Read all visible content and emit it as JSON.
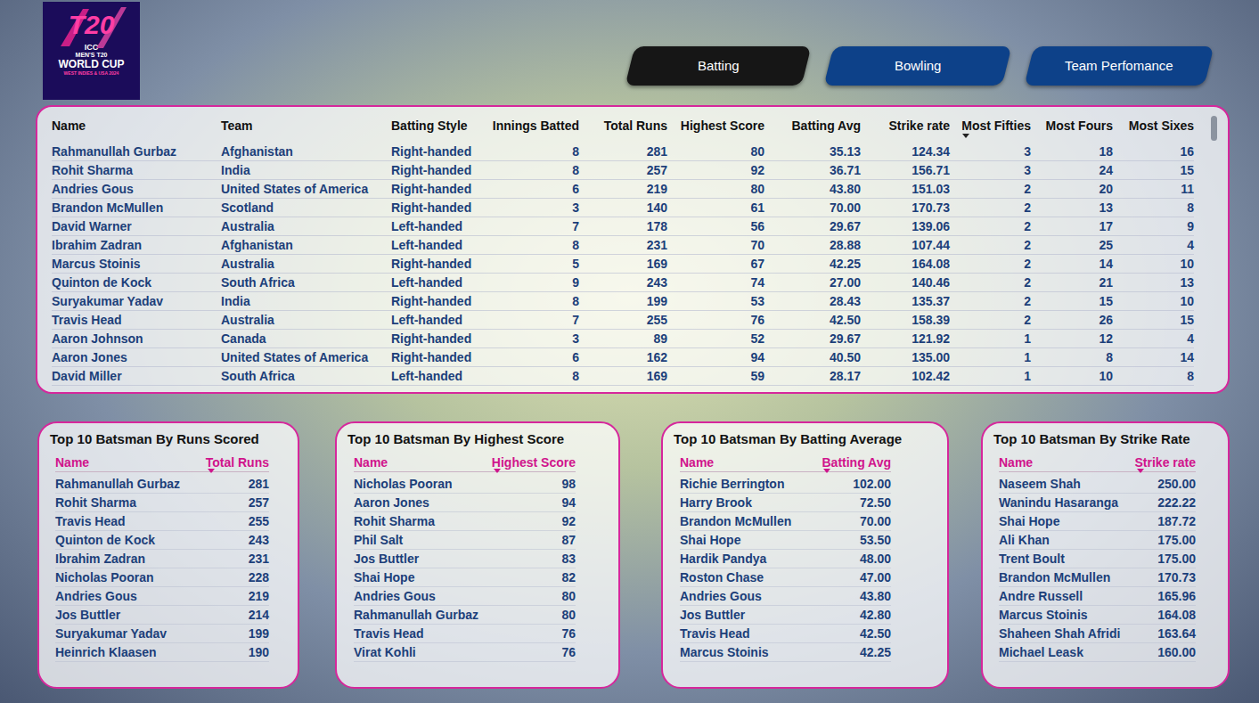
{
  "logo": {
    "mark": "T20",
    "line1": "ICC",
    "line2": "MEN'S T20",
    "line3": "WORLD CUP",
    "line4": "WEST INDIES & USA 2024"
  },
  "tabs": [
    {
      "label": "Batting",
      "selected": true
    },
    {
      "label": "Bowling",
      "selected": false
    },
    {
      "label": "Team Perfomance",
      "selected": false
    }
  ],
  "table": {
    "columns": [
      {
        "label": "Name",
        "sorted": false
      },
      {
        "label": "Team",
        "sorted": false
      },
      {
        "label": "Batting Style",
        "sorted": false
      },
      {
        "label": "Innings Batted",
        "sorted": false
      },
      {
        "label": "Total Runs",
        "sorted": false
      },
      {
        "label": "Highest Score",
        "sorted": false
      },
      {
        "label": "Batting Avg",
        "sorted": false
      },
      {
        "label": "Strike rate",
        "sorted": false
      },
      {
        "label": "Most Fifties",
        "sorted": true
      },
      {
        "label": "Most Fours",
        "sorted": false
      },
      {
        "label": "Most Sixes",
        "sorted": false
      }
    ],
    "rows": [
      [
        "Rahmanullah Gurbaz",
        "Afghanistan",
        "Right-handed",
        "8",
        "281",
        "80",
        "35.13",
        "124.34",
        "3",
        "18",
        "16"
      ],
      [
        "Rohit Sharma",
        "India",
        "Right-handed",
        "8",
        "257",
        "92",
        "36.71",
        "156.71",
        "3",
        "24",
        "15"
      ],
      [
        "Andries Gous",
        "United States of America",
        "Right-handed",
        "6",
        "219",
        "80",
        "43.80",
        "151.03",
        "2",
        "20",
        "11"
      ],
      [
        "Brandon McMullen",
        "Scotland",
        "Right-handed",
        "3",
        "140",
        "61",
        "70.00",
        "170.73",
        "2",
        "13",
        "8"
      ],
      [
        "David Warner",
        "Australia",
        "Left-handed",
        "7",
        "178",
        "56",
        "29.67",
        "139.06",
        "2",
        "17",
        "9"
      ],
      [
        "Ibrahim Zadran",
        "Afghanistan",
        "Left-handed",
        "8",
        "231",
        "70",
        "28.88",
        "107.44",
        "2",
        "25",
        "4"
      ],
      [
        "Marcus Stoinis",
        "Australia",
        "Right-handed",
        "5",
        "169",
        "67",
        "42.25",
        "164.08",
        "2",
        "14",
        "10"
      ],
      [
        "Quinton de Kock",
        "South Africa",
        "Left-handed",
        "9",
        "243",
        "74",
        "27.00",
        "140.46",
        "2",
        "21",
        "13"
      ],
      [
        "Suryakumar Yadav",
        "India",
        "Right-handed",
        "8",
        "199",
        "53",
        "28.43",
        "135.37",
        "2",
        "15",
        "10"
      ],
      [
        "Travis Head",
        "Australia",
        "Left-handed",
        "7",
        "255",
        "76",
        "42.50",
        "158.39",
        "2",
        "26",
        "15"
      ],
      [
        "Aaron Johnson",
        "Canada",
        "Right-handed",
        "3",
        "89",
        "52",
        "29.67",
        "121.92",
        "1",
        "12",
        "4"
      ],
      [
        "Aaron Jones",
        "United States of America",
        "Right-handed",
        "6",
        "162",
        "94",
        "40.50",
        "135.00",
        "1",
        "8",
        "14"
      ],
      [
        "David Miller",
        "South Africa",
        "Left-handed",
        "8",
        "169",
        "59",
        "28.17",
        "102.42",
        "1",
        "10",
        "8"
      ]
    ]
  },
  "cards": [
    {
      "title": "Top 10 Batsman By Runs Scored",
      "columns": [
        {
          "label": "Name",
          "sorted": false
        },
        {
          "label": "Total Runs",
          "sorted": true
        }
      ],
      "rows": [
        [
          "Rahmanullah Gurbaz",
          "281"
        ],
        [
          "Rohit Sharma",
          "257"
        ],
        [
          "Travis Head",
          "255"
        ],
        [
          "Quinton de Kock",
          "243"
        ],
        [
          "Ibrahim Zadran",
          "231"
        ],
        [
          "Nicholas Pooran",
          "228"
        ],
        [
          "Andries Gous",
          "219"
        ],
        [
          "Jos Buttler",
          "214"
        ],
        [
          "Suryakumar Yadav",
          "199"
        ],
        [
          "Heinrich Klaasen",
          "190"
        ]
      ]
    },
    {
      "title": "Top 10 Batsman By Highest Score",
      "columns": [
        {
          "label": "Name",
          "sorted": false
        },
        {
          "label": "Highest Score",
          "sorted": true
        }
      ],
      "rows": [
        [
          "Nicholas Pooran",
          "98"
        ],
        [
          "Aaron Jones",
          "94"
        ],
        [
          "Rohit Sharma",
          "92"
        ],
        [
          "Phil Salt",
          "87"
        ],
        [
          "Jos Buttler",
          "83"
        ],
        [
          "Shai Hope",
          "82"
        ],
        [
          "Andries Gous",
          "80"
        ],
        [
          "Rahmanullah Gurbaz",
          "80"
        ],
        [
          "Travis Head",
          "76"
        ],
        [
          "Virat Kohli",
          "76"
        ]
      ]
    },
    {
      "title": "Top 10 Batsman By Batting Average",
      "columns": [
        {
          "label": "Name",
          "sorted": false
        },
        {
          "label": "Batting Avg",
          "sorted": true
        }
      ],
      "rows": [
        [
          "Richie Berrington",
          "102.00"
        ],
        [
          "Harry Brook",
          "72.50"
        ],
        [
          "Brandon McMullen",
          "70.00"
        ],
        [
          "Shai Hope",
          "53.50"
        ],
        [
          "Hardik Pandya",
          "48.00"
        ],
        [
          "Roston Chase",
          "47.00"
        ],
        [
          "Andries Gous",
          "43.80"
        ],
        [
          "Jos Buttler",
          "42.80"
        ],
        [
          "Travis Head",
          "42.50"
        ],
        [
          "Marcus Stoinis",
          "42.25"
        ]
      ]
    },
    {
      "title": "Top 10 Batsman By Strike Rate",
      "columns": [
        {
          "label": "Name",
          "sorted": false
        },
        {
          "label": "Strike rate",
          "sorted": true
        }
      ],
      "rows": [
        [
          "Naseem Shah",
          "250.00"
        ],
        [
          "Wanindu Hasaranga",
          "222.22"
        ],
        [
          "Shai Hope",
          "187.72"
        ],
        [
          "Ali Khan",
          "175.00"
        ],
        [
          "Trent Boult",
          "175.00"
        ],
        [
          "Brandon McMullen",
          "170.73"
        ],
        [
          "Andre Russell",
          "165.96"
        ],
        [
          "Marcus Stoinis",
          "164.08"
        ],
        [
          "Shaheen Shah Afridi",
          "163.64"
        ],
        [
          "Michael Leask",
          "160.00"
        ]
      ]
    }
  ]
}
